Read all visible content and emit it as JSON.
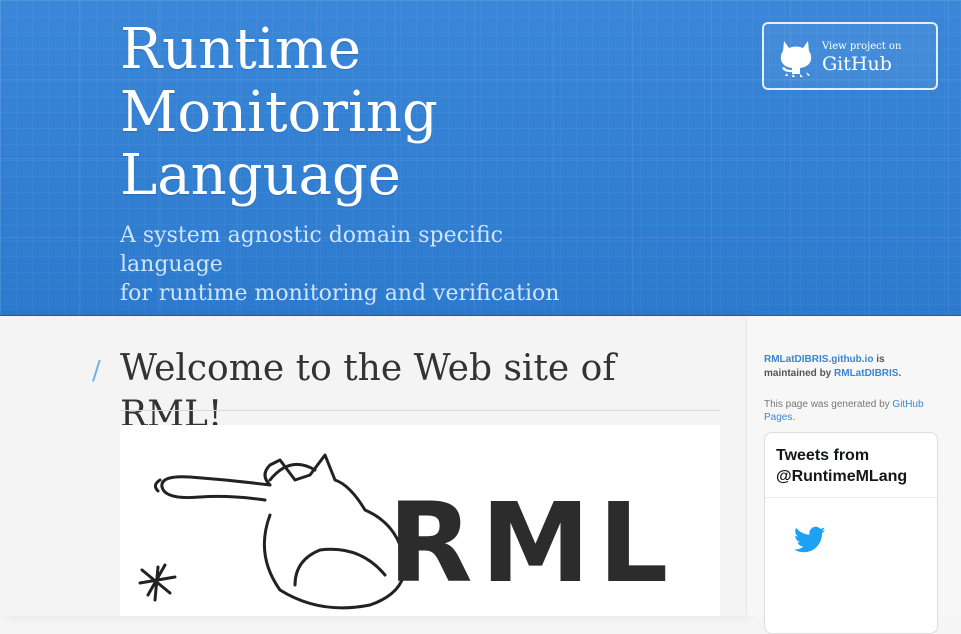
{
  "header": {
    "title_lines": [
      "Runtime",
      "Monitoring",
      "Language"
    ],
    "tagline_lines": [
      "A system agnostic domain specific language",
      "for runtime monitoring and verification"
    ],
    "github": {
      "small": "View project on",
      "big": "GitHub"
    }
  },
  "main": {
    "slash": "/",
    "heading": "Welcome to the Web site of RML!",
    "logo_text": "RML"
  },
  "sidebar": {
    "maintained": {
      "site": "RMLatDIBRIS.github.io",
      "middle": " is maintained by ",
      "user": "RMLatDIBRIS",
      "end": "."
    },
    "generated": {
      "prefix": "This page was generated by ",
      "link": "GitHub Pages",
      "end": "."
    },
    "tweets_title_lines": [
      "Tweets from",
      "@RuntimeMLang"
    ]
  },
  "colors": {
    "header_blue": "#2e7fd6",
    "link_blue": "#3a86d1",
    "twitter_blue": "#1da1f2"
  },
  "icons": [
    "github-octocat-icon",
    "twitter-bird-icon"
  ]
}
